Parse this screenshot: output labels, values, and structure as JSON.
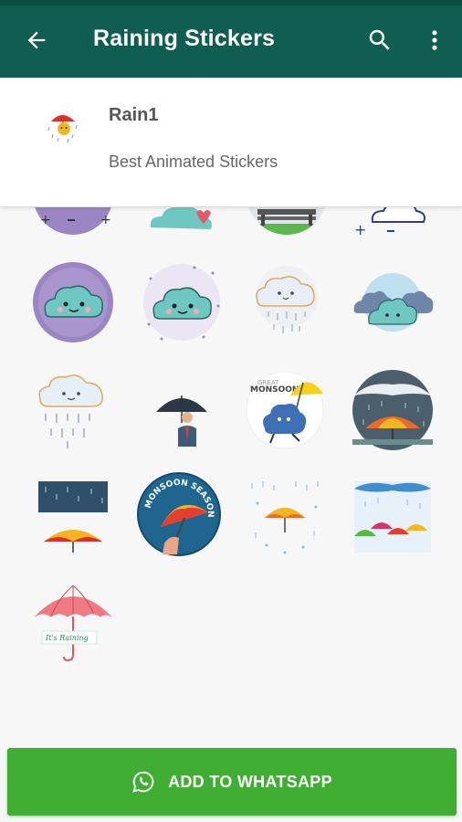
{
  "app_bar": {
    "title": "Raining Stickers",
    "back_icon": "arrow-left-icon",
    "search_icon": "search-icon",
    "more_icon": "more-vertical-icon",
    "color": "#0f5e51"
  },
  "pack": {
    "name": "Rain1",
    "publisher": "Best Animated Stickers"
  },
  "stickers": [
    {
      "name": "sticker-cloud-purple-circle-partial"
    },
    {
      "name": "sticker-cloud-heart-partial"
    },
    {
      "name": "sticker-park-bench-partial"
    },
    {
      "name": "sticker-cloud-plus-minus-partial"
    },
    {
      "name": "sticker-cloud-purple-circle"
    },
    {
      "name": "sticker-cloud-sparkles"
    },
    {
      "name": "sticker-cloud-raining"
    },
    {
      "name": "sticker-three-clouds"
    },
    {
      "name": "sticker-cloud-raindrops"
    },
    {
      "name": "sticker-man-umbrella"
    },
    {
      "name": "sticker-great-monsoon",
      "text1": "GREAT",
      "text2": "MONSOON"
    },
    {
      "name": "sticker-umbrella-rain-circle"
    },
    {
      "name": "sticker-rain-sky-umbrella"
    },
    {
      "name": "sticker-monsoon-season",
      "text": "MONSOON SEASON"
    },
    {
      "name": "sticker-umbrella-raindrops"
    },
    {
      "name": "sticker-colorful-umbrellas"
    },
    {
      "name": "sticker-its-raining",
      "text": "It's Raining"
    }
  ],
  "add_button": {
    "label": "ADD TO WHATSAPP",
    "icon": "whatsapp-icon",
    "color": "#3fae32"
  }
}
